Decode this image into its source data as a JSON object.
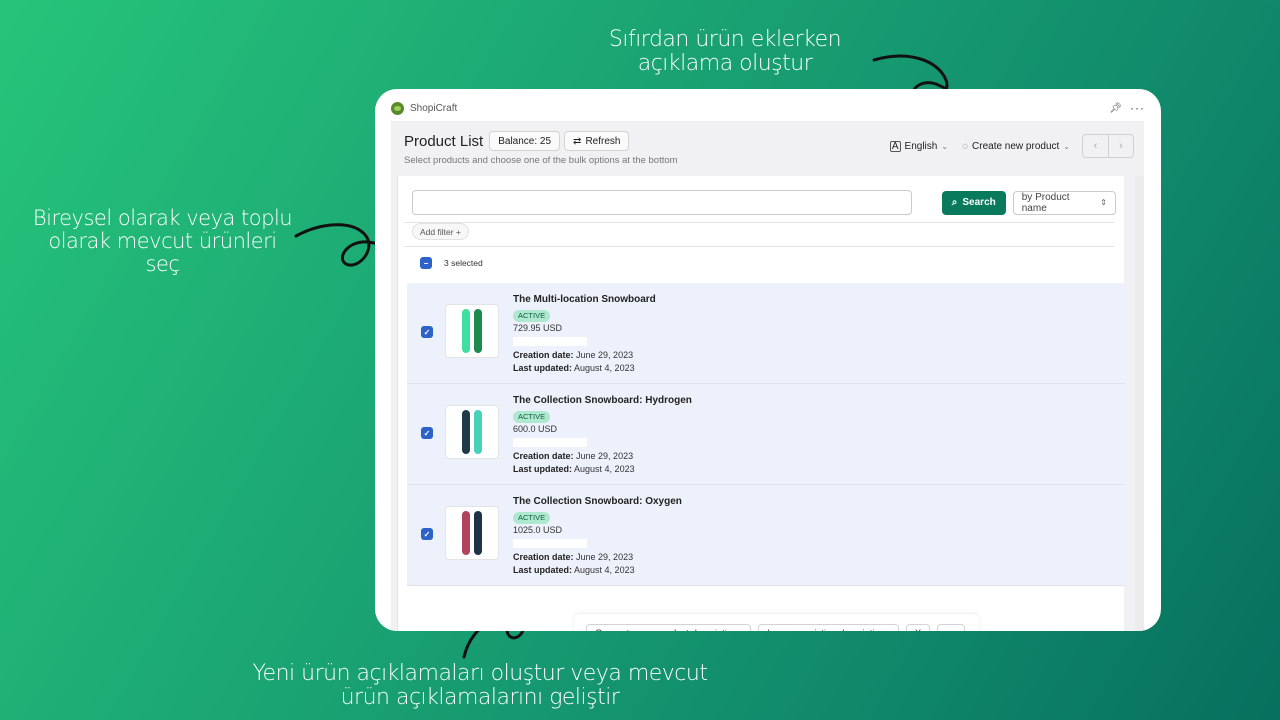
{
  "annotations": {
    "top": "Sıfırdan ürün eklerken açıklama oluştur",
    "left": "Bireysel olarak veya toplu olarak mevcut ürünleri seç",
    "bottom": "Yeni  ürün açıklamaları oluştur veya mevcut ürün açıklamalarını geliştir"
  },
  "app": {
    "name": "ShopiCraft",
    "pin_icon": "pin-icon",
    "more_icon": "more-icon"
  },
  "header": {
    "title": "Product List",
    "balance_label": "Balance: 25",
    "refresh_label": "Refresh",
    "subtitle": "Select products and choose one of the bulk options at the bottom",
    "language": "English",
    "create_label": "Create new product",
    "prev_label": "‹",
    "next_label": "›"
  },
  "search": {
    "value": "",
    "placeholder": "",
    "button_label": "Search",
    "sort_value": "by Product name"
  },
  "filter": {
    "add_label": "Add filter +"
  },
  "selection": {
    "label": "3 selected"
  },
  "products": [
    {
      "name": "The Multi-location Snowboard",
      "status": "ACTIVE",
      "price": "729.95 USD",
      "creation_label": "Creation date:",
      "creation_date": "June 29, 2023",
      "updated_label": "Last updated:",
      "updated_date": "August 4, 2023",
      "colors": [
        "#3ee0a0",
        "#1f8a4e"
      ]
    },
    {
      "name": "The Collection Snowboard: Hydrogen",
      "status": "ACTIVE",
      "price": "600.0 USD",
      "creation_label": "Creation date:",
      "creation_date": "June 29, 2023",
      "updated_label": "Last updated:",
      "updated_date": "August 4, 2023",
      "colors": [
        "#1e3a4a",
        "#46d1b8"
      ]
    },
    {
      "name": "The Collection Snowboard: Oxygen",
      "status": "ACTIVE",
      "price": "1025.0 USD",
      "creation_label": "Creation date:",
      "creation_date": "June 29, 2023",
      "updated_label": "Last updated:",
      "updated_date": "August 4, 2023",
      "colors": [
        "#b2435e",
        "#1f3348"
      ]
    }
  ],
  "bulk_actions": {
    "generate_label": "Generate new product descriptions",
    "improve_label": "Improve existing descriptions",
    "close_label": "X",
    "more_label": "···"
  },
  "colors": {
    "accent": "#0a7a5c",
    "checkbox": "#2d62c8",
    "row_bg": "#edf1fb",
    "badge_bg": "#aee9cf"
  }
}
